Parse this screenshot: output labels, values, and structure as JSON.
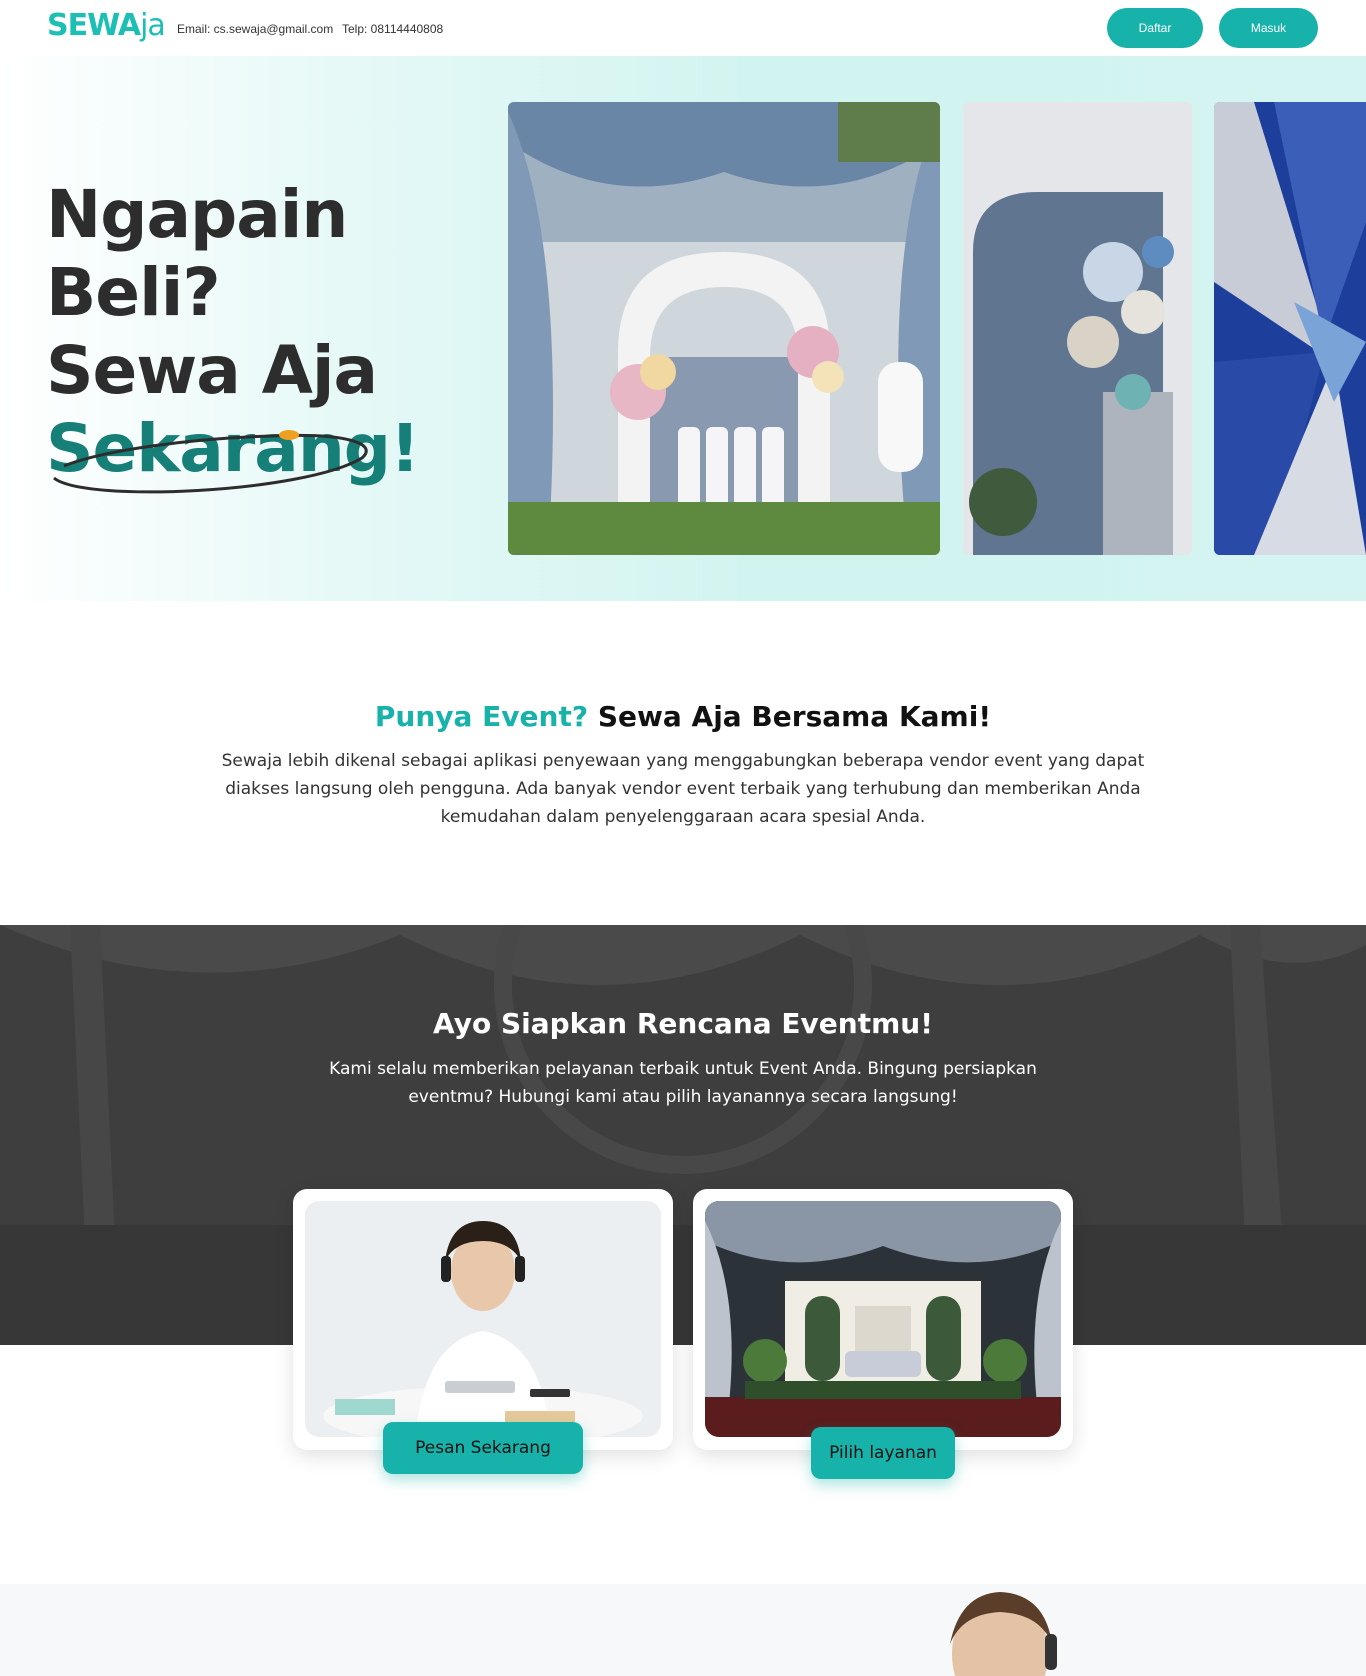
{
  "header": {
    "logo_main": "SEW",
    "logo_a": "A",
    "logo_aja": "ja",
    "email": "Email: cs.sewaja@gmail.com",
    "telp": "Telp: 08114440808",
    "daftar_label": "Daftar",
    "masuk_label": "Masuk"
  },
  "hero": {
    "line1": "Ngapain",
    "line2": "Beli?",
    "line3": "Sewa Aja",
    "line4": "Sekarang!"
  },
  "about": {
    "title_accent": "Punya Event?",
    "title_rest": " Sewa Aja Bersama Kami!",
    "text": "Sewaja lebih dikenal sebagai aplikasi penyewaan yang menggabungkan beberapa vendor event yang dapat diakses langsung oleh pengguna. Ada banyak vendor event terbaik yang terhubung dan memberikan Anda kemudahan dalam penyelenggaraan acara spesial Anda."
  },
  "plan": {
    "title": "Ayo Siapkan Rencana Eventmu!",
    "text": "Kami selalu memberikan pelayanan terbaik untuk Event Anda. Bingung persiapkan eventmu? Hubungi kami atau pilih layanannya secara langsung!"
  },
  "cards": {
    "pesan_label": "Pesan Sekarang",
    "pilih_label": "Pilih layanan"
  },
  "colors": {
    "accent": "#17b3aa",
    "accent_dark": "#157f78",
    "dark_bg": "#3a3a3a"
  }
}
